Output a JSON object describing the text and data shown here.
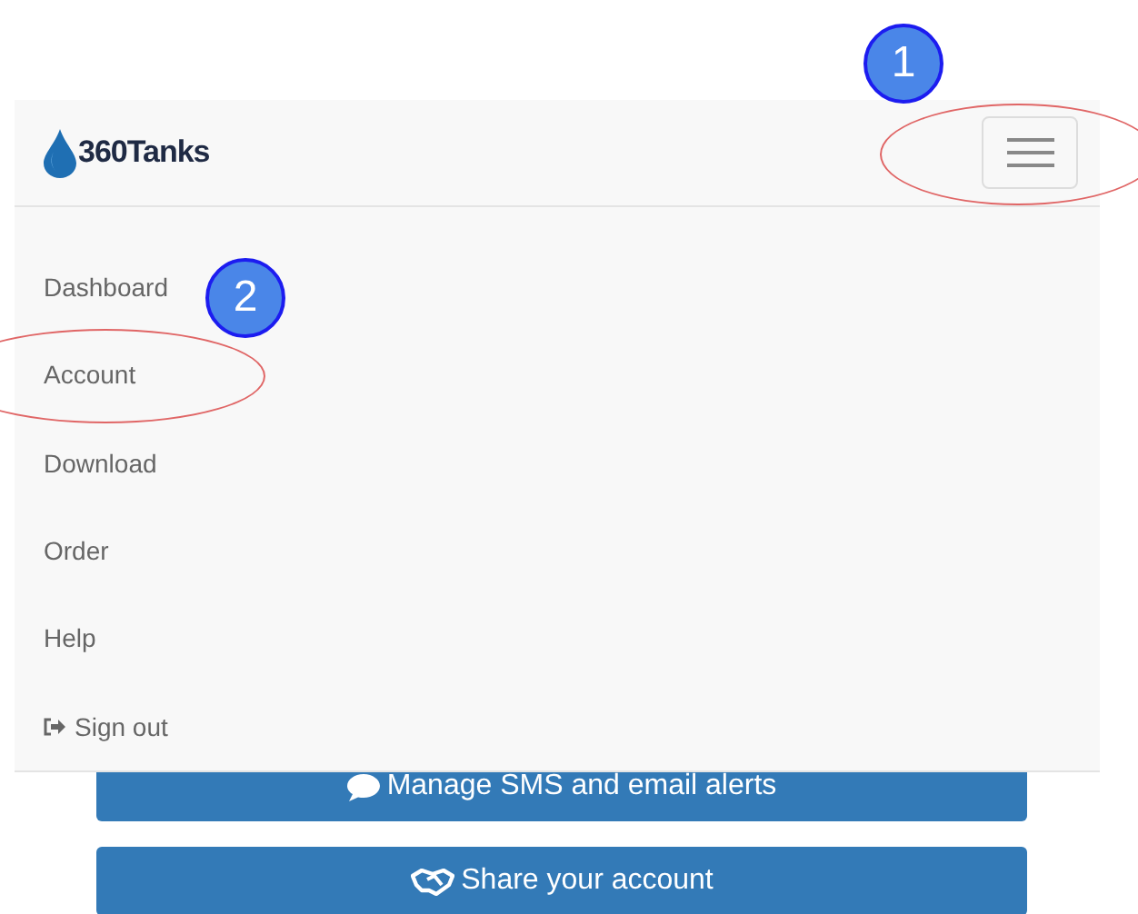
{
  "navbar": {
    "brand": "360Tanks"
  },
  "menu": {
    "items": [
      {
        "label": "Dashboard",
        "kind": "link"
      },
      {
        "label": "Account",
        "kind": "link"
      },
      {
        "label": "Download",
        "kind": "link"
      },
      {
        "label": "Order",
        "kind": "link"
      },
      {
        "label": "Help",
        "kind": "link"
      },
      {
        "label": "Sign out",
        "kind": "signout"
      }
    ]
  },
  "buttons": [
    {
      "label": "Manage SMS and email alerts",
      "kind": "chat"
    },
    {
      "label": "Share your account",
      "kind": "share"
    }
  ],
  "annotations": [
    {
      "label": "1"
    },
    {
      "label": "2"
    }
  ]
}
